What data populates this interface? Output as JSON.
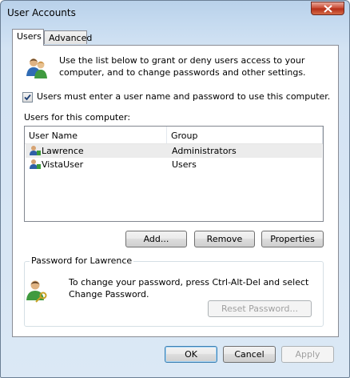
{
  "window": {
    "title": "User Accounts"
  },
  "tabs": [
    {
      "label": "Users",
      "active": true
    },
    {
      "label": "Advanced",
      "active": false
    }
  ],
  "intro": {
    "icon": "users-icon",
    "text": "Use the list below to grant or deny users access to your computer, and to change passwords and other settings."
  },
  "require_password": {
    "label": "Users must enter a user name and password to use this computer.",
    "checked": true
  },
  "users_list": {
    "label": "Users for this computer:",
    "columns": [
      "User Name",
      "Group"
    ],
    "rows": [
      {
        "name": "Lawrence",
        "group": "Administrators",
        "selected": true
      },
      {
        "name": "VistaUser",
        "group": "Users",
        "selected": false
      }
    ]
  },
  "list_buttons": {
    "add": "Add...",
    "remove": "Remove",
    "properties": "Properties"
  },
  "password_group": {
    "title": "Password for Lawrence",
    "icon": "user-key-icon",
    "text": "To change your password, press Ctrl-Alt-Del and select Change Password.",
    "reset_button": "Reset Password..."
  },
  "dialog_buttons": {
    "ok": "OK",
    "cancel": "Cancel",
    "apply": "Apply"
  },
  "colors": {
    "titlebar": "#c6dbf0",
    "close_button": "#c7452d",
    "default_button_border": "#3c7fb1"
  }
}
